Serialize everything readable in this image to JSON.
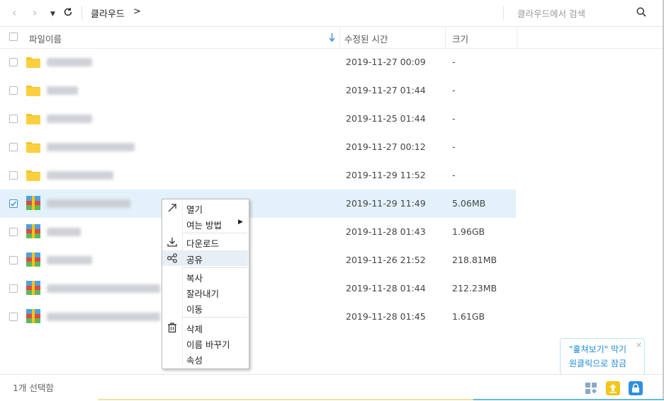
{
  "toolbar": {
    "breadcrumb": "클라우드",
    "breadcrumb_arrow": ">",
    "search_placeholder": "클라우드에서 검색"
  },
  "columns": {
    "name": "파일이름",
    "modified": "수정된 시간",
    "size": "크기"
  },
  "rows": [
    {
      "type": "folder",
      "date": "2019-11-27 00:09",
      "size": "-",
      "selected": false
    },
    {
      "type": "folder",
      "date": "2019-11-27 01:44",
      "size": "-",
      "selected": false
    },
    {
      "type": "folder",
      "date": "2019-11-25 01:44",
      "size": "-",
      "selected": false
    },
    {
      "type": "folder",
      "date": "2019-11-27 00:12",
      "size": "-",
      "selected": false
    },
    {
      "type": "folder",
      "date": "2019-11-29 11:52",
      "size": "-",
      "selected": false
    },
    {
      "type": "archive",
      "date": "2019-11-29 11:49",
      "size": "5.06MB",
      "selected": true
    },
    {
      "type": "archive",
      "date": "2019-11-28 01:43",
      "size": "1.96GB",
      "selected": false
    },
    {
      "type": "archive",
      "date": "2019-11-26 21:52",
      "size": "218.81MB",
      "selected": false
    },
    {
      "type": "archive",
      "date": "2019-11-28 01:44",
      "size": "212.23MB",
      "selected": false
    },
    {
      "type": "archive",
      "date": "2019-11-28 01:45",
      "size": "1.61GB",
      "selected": false
    }
  ],
  "context_menu": {
    "open": "열기",
    "open_with": "여는 방법",
    "download": "다운로드",
    "share": "공유",
    "copy": "복사",
    "cut": "잘라내기",
    "move": "이동",
    "delete": "삭제",
    "rename": "이름 바꾸기",
    "properties": "속성"
  },
  "footer": {
    "selection_status": "1개 선택함"
  },
  "tooltip": {
    "line1": "\"훑쳐보기\" 막기",
    "line2": "원클릭으로 잠금",
    "close": "×"
  },
  "colors": {
    "accent": "#3d8fd8",
    "selected_row": "#e3f1fb",
    "folder": "#f7c325",
    "tooltip_text": "#1e8ad6"
  }
}
